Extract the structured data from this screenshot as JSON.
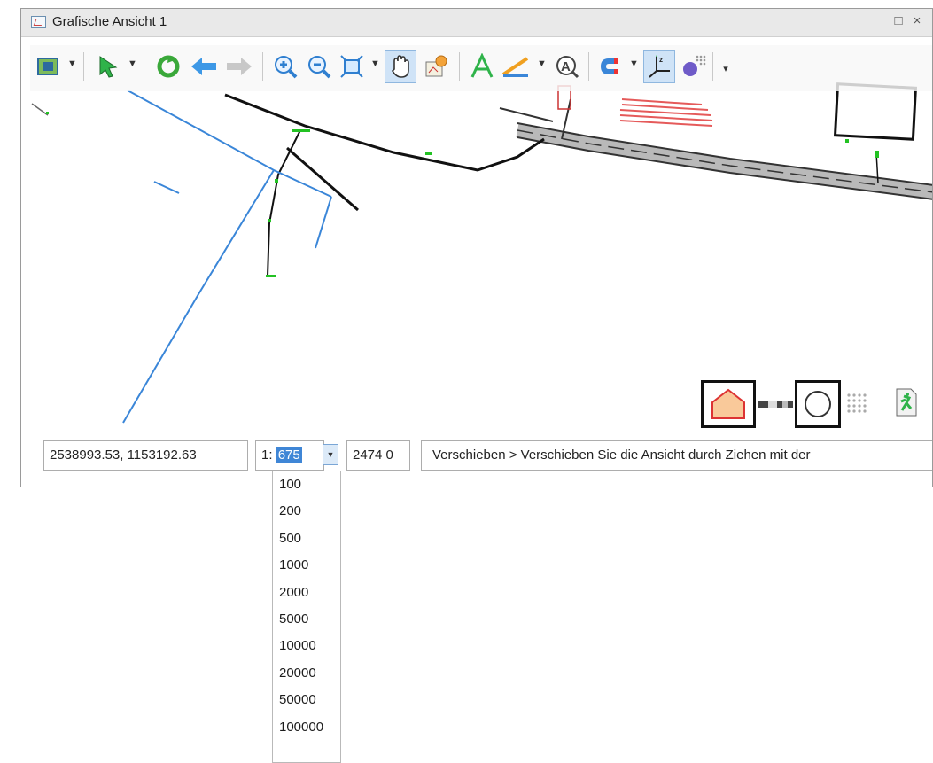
{
  "window": {
    "title": "Grafische Ansicht 1"
  },
  "window_controls": [
    "_",
    "□",
    "×"
  ],
  "toolbar": {
    "tools": [
      {
        "icon": "layer-view-icon",
        "dropdown": true
      },
      {
        "icon": "select-arrow-icon",
        "dropdown": true
      },
      {
        "icon": "refresh-icon",
        "dropdown": false
      },
      {
        "icon": "back-arrow-icon",
        "dropdown": false
      },
      {
        "icon": "forward-arrow-icon",
        "dropdown": false
      },
      {
        "icon": "zoom-in-icon",
        "dropdown": false
      },
      {
        "icon": "zoom-out-icon",
        "dropdown": false
      },
      {
        "icon": "zoom-extent-icon",
        "dropdown": true
      },
      {
        "icon": "pan-hand-icon",
        "dropdown": false,
        "active": true
      },
      {
        "icon": "refresh-map-icon",
        "dropdown": false
      },
      {
        "icon": "text-icon",
        "dropdown": false
      },
      {
        "icon": "measure-icon",
        "dropdown": true
      },
      {
        "icon": "find-text-icon",
        "dropdown": false
      },
      {
        "icon": "snap-magnet-icon",
        "dropdown": true
      },
      {
        "icon": "coordinate-axes-icon",
        "dropdown": false
      },
      {
        "icon": "grid-snap-icon",
        "dropdown": false
      }
    ]
  },
  "status": {
    "coordinates": "2538993.53, 1153192.63",
    "scale_prefix": "1:",
    "scale_value": "675",
    "rotation": "2474  0",
    "message": "Verschieben > Verschieben Sie die Ansicht durch Ziehen mit der"
  },
  "scale_options": [
    "100",
    "200",
    "500",
    "1000",
    "2000",
    "5000",
    "10000",
    "20000",
    "50000",
    "100000"
  ],
  "corner_tools": [
    "polygon-house-icon",
    "slider-track-icon",
    "circle-select-icon",
    "dot-grid-icon",
    "exit-figure-icon"
  ],
  "colors": {
    "accent": "#3f86d6",
    "blue_line": "#3a86d8",
    "red_hatch": "#e55a5a",
    "green_marker": "#23c223",
    "polygon_fill": "#f9c99a"
  }
}
